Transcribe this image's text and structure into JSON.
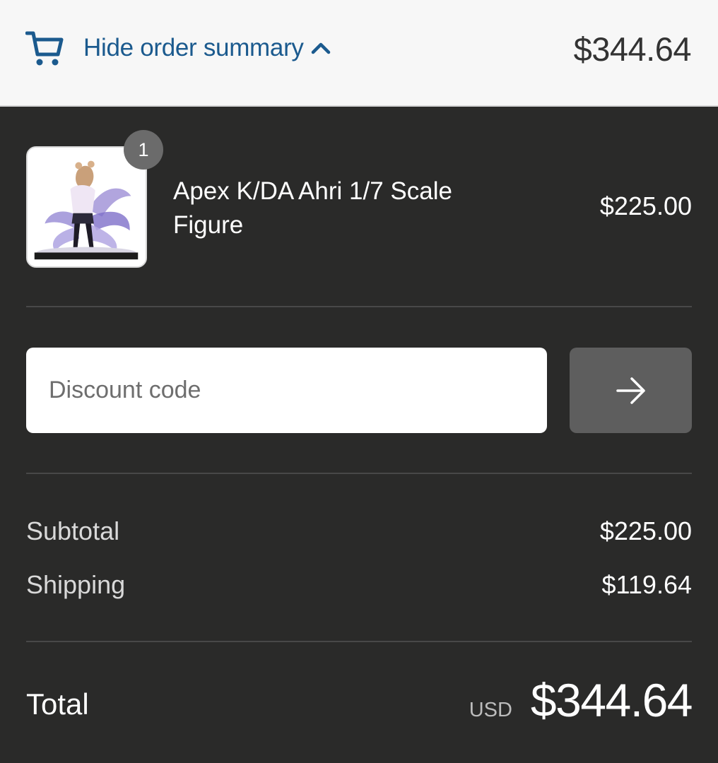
{
  "header": {
    "toggle_label": "Hide order summary",
    "total": "$344.64",
    "icons": [
      "cart-icon",
      "chevron-up-icon"
    ],
    "accent_color": "#1b5a8e"
  },
  "line_items": [
    {
      "name": "Apex K/DA Ahri 1/7 Scale Figure",
      "price": "$225.00",
      "quantity": "1",
      "image": "figure-thumbnail"
    }
  ],
  "discount": {
    "placeholder": "Discount code",
    "value": "",
    "apply_icon": "arrow-right-icon"
  },
  "costs": {
    "subtotal_label": "Subtotal",
    "subtotal": "$225.00",
    "shipping_label": "Shipping",
    "shipping": "$119.64"
  },
  "total": {
    "label": "Total",
    "currency": "USD",
    "amount": "$344.64"
  },
  "colors": {
    "panel_background": "#2a2a29",
    "header_background": "#f7f7f7",
    "button_background": "#5e5e5e"
  }
}
